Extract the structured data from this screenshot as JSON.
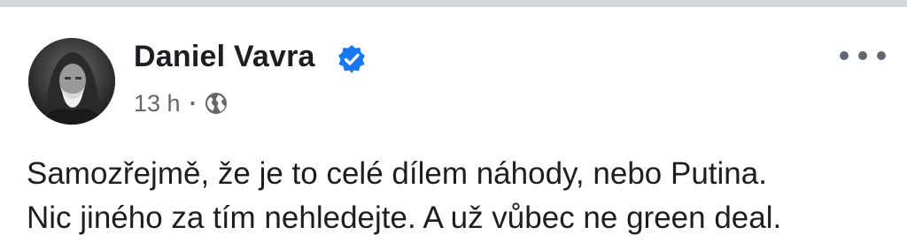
{
  "post": {
    "author": "Daniel Vavra",
    "verified": true,
    "time": "13 h",
    "separator": "·",
    "audience_icon": "globe-icon",
    "more_icon": "more-horizontal-icon",
    "text_lines": [
      "Samozřejmě, že je to celé dílem náhody, nebo Putina.",
      "Nic jiného za tím nehledejte. A už vůbec ne green deal."
    ]
  },
  "colors": {
    "name": "#1c1e21",
    "meta": "#65676b",
    "verified": "#1877f2",
    "divider": "#d4d6da"
  }
}
